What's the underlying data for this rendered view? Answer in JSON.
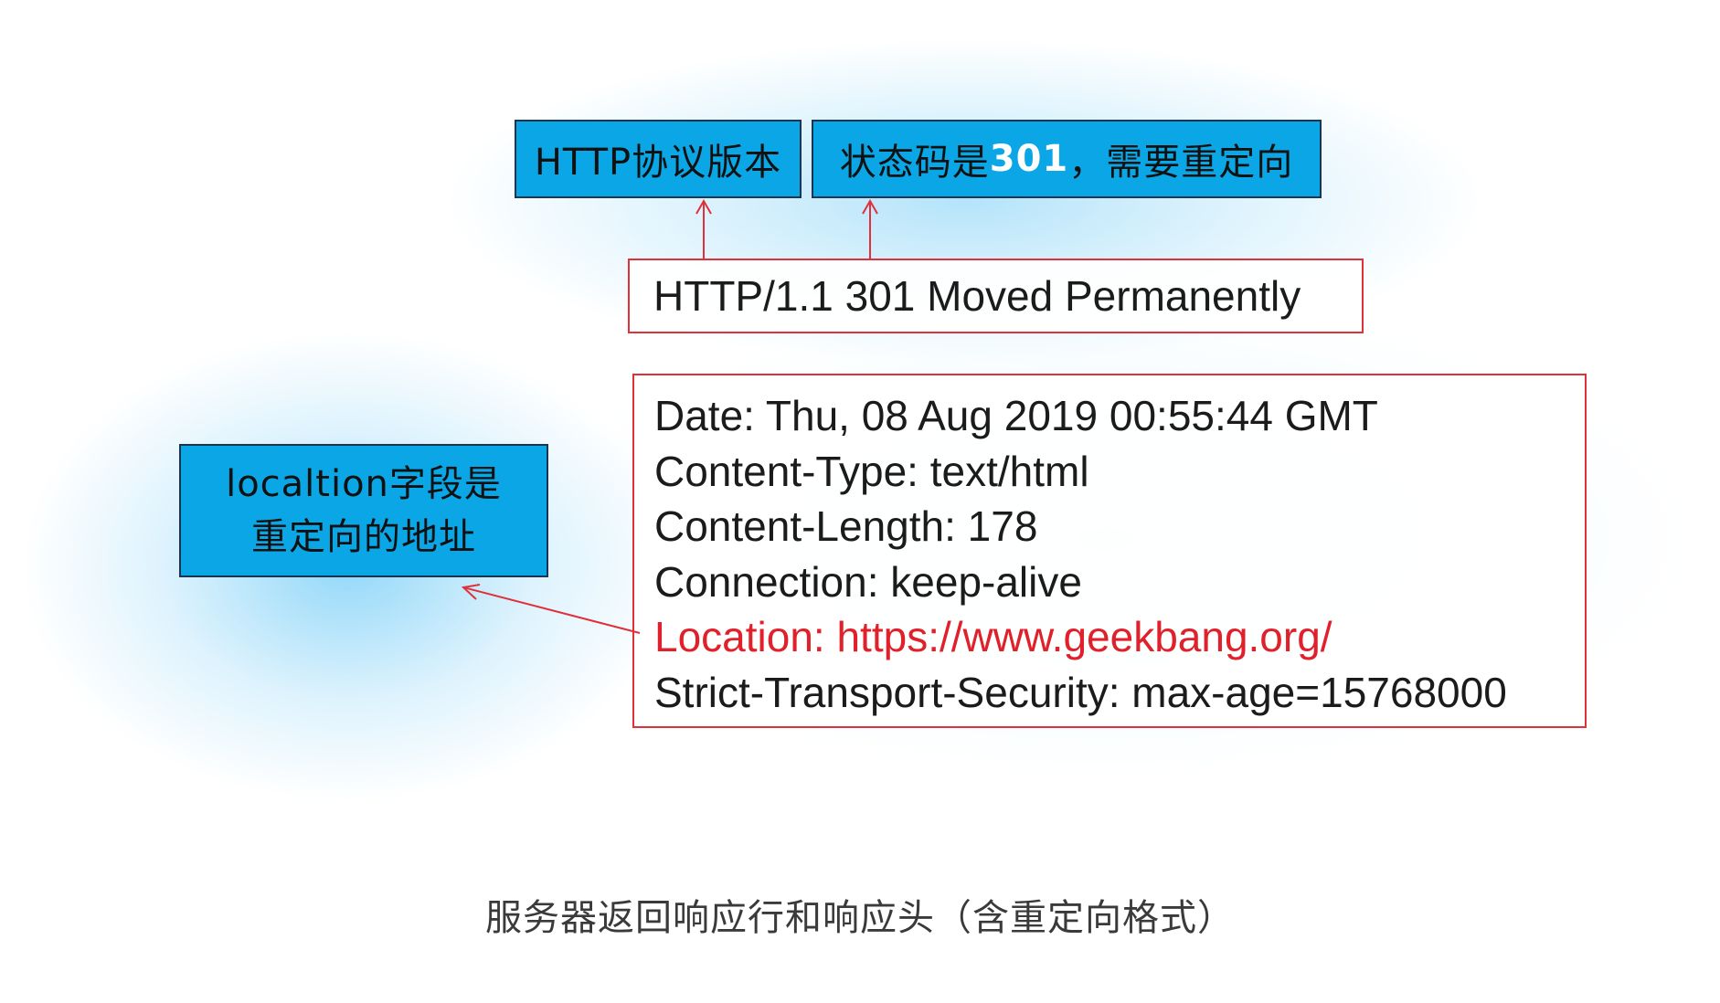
{
  "labels": {
    "http_version": "HTTP协议版本",
    "status_prefix": "状态码是",
    "status_number": "301",
    "status_suffix": "，需要重定向",
    "location_line1": "localtion字段是",
    "location_line2": "重定向的地址"
  },
  "response": {
    "status_line": "HTTP/1.1 301 Moved Permanently",
    "headers": [
      "Date: Thu, 08 Aug 2019 00:55:44 GMT",
      "Content-Type: text/html",
      "Content-Length: 178",
      "Connection: keep-alive",
      "Location: https://www.geekbang.org/",
      "Strict-Transport-Security: max-age=15768000"
    ]
  },
  "caption": "服务器返回响应行和响应头（含重定向格式）",
  "colors": {
    "label_fill": "#0aa6e6",
    "label_border": "#1a3550",
    "highlight_red": "#e0202a",
    "box_border_red": "#e0303a"
  }
}
